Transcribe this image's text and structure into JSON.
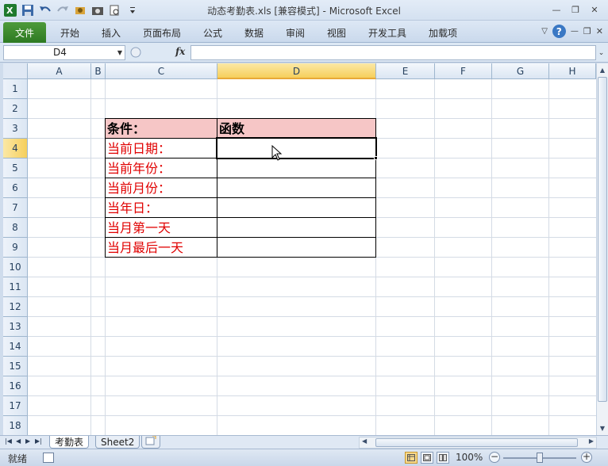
{
  "window": {
    "title": "动态考勤表.xls  [兼容模式]  -  Microsoft Excel"
  },
  "ribbon": {
    "file_tab": "文件",
    "tabs": [
      "开始",
      "插入",
      "页面布局",
      "公式",
      "数据",
      "审阅",
      "视图",
      "开发工具",
      "加载项"
    ]
  },
  "formula_bar": {
    "name_box": "D4",
    "fx_label": "fx",
    "content": ""
  },
  "grid": {
    "columns": [
      "A",
      "B",
      "C",
      "D",
      "E",
      "F",
      "G",
      "H"
    ],
    "active_column": "D",
    "rows": [
      "1",
      "2",
      "3",
      "4",
      "5",
      "6",
      "7",
      "8",
      "9",
      "10",
      "11",
      "12",
      "13",
      "14",
      "15",
      "16",
      "17",
      "18"
    ],
    "active_row": "4"
  },
  "table": {
    "header_condition": "条件：",
    "header_function": "函数",
    "labels": [
      "当前日期：",
      "当前年份：",
      "当前月份：",
      "当年日：",
      "当月第一天",
      "当月最后一天"
    ]
  },
  "sheets": {
    "tabs": [
      "考勤表",
      "Sheet2"
    ],
    "active": "考勤表"
  },
  "status": {
    "ready": "就绪",
    "zoom": "100%"
  },
  "colors": {
    "header_fill": "#f6c6c6",
    "label_text": "#e00000",
    "file_tab": "#2d7a22",
    "active_header": "#f6cf5c"
  }
}
